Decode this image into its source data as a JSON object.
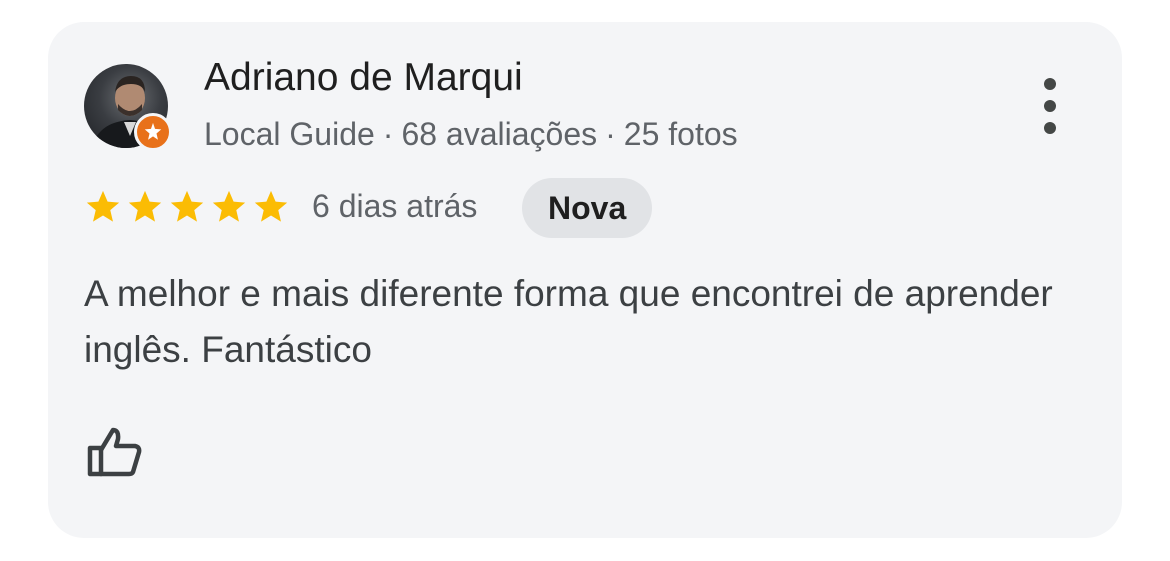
{
  "reviewer": {
    "name": "Adriano de Marqui",
    "role": "Local Guide",
    "reviews_count": "68 avaliações",
    "photos_count": "25 fotos",
    "separator": "·"
  },
  "rating": {
    "stars": 5,
    "max_stars": 5,
    "time_ago": "6 dias atrás",
    "badge": "Nova",
    "star_color": "#fbbc04"
  },
  "review": {
    "text": "A melhor e mais diferente forma que encontrei de aprender inglês. Fantástico"
  },
  "icons": {
    "menu": "more-vert-icon",
    "like": "thumbs-up-icon",
    "guide": "local-guide-star-icon"
  },
  "colors": {
    "card_bg": "#f4f5f7",
    "badge_bg": "#e1e3e6",
    "guide_orange": "#e8711a"
  }
}
